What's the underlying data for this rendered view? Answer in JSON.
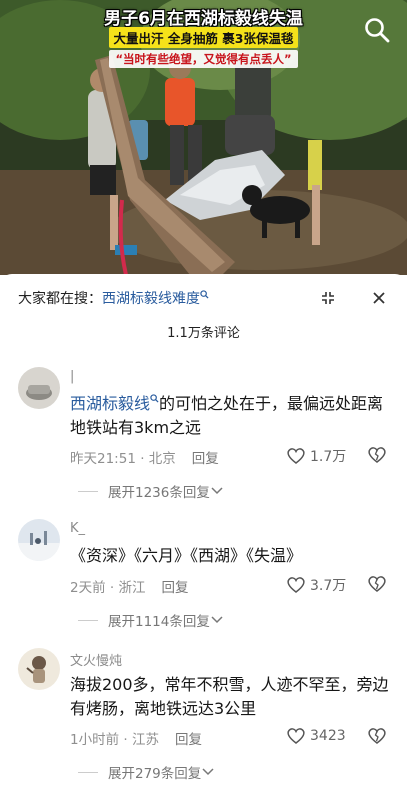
{
  "video": {
    "headline_line1": "男子6月在西湖标毅线失温",
    "headline_line2": "大量出汗 全身抽筋 裹3张保温毯",
    "headline_line3": "“当时有些绝望，又觉得有点丢人”"
  },
  "search_bar": {
    "prefix": "大家都在搜：",
    "query": "西湖标毅线难度"
  },
  "comments_count": "1.1万条评论",
  "comments": [
    {
      "username": "|",
      "text_tag": "西湖标毅线",
      "text_rest": "的可怕之处在于，最偏远处距离地铁站有3km之远",
      "meta": "昨天21:51 · 北京",
      "reply_label": "回复",
      "likes": "1.7万",
      "expand_label": "展开1236条回复"
    },
    {
      "username": "K_",
      "text_tag": "",
      "text_rest": "《资深》《六月》《西湖》《失温》",
      "meta": "2天前 · 浙江",
      "reply_label": "回复",
      "likes": "3.7万",
      "expand_label": "展开1114条回复"
    },
    {
      "username": "文火慢炖",
      "text_tag": "",
      "text_rest": "海拔200多，常年不积雪，人迹不罕至，旁边有烤肠，离地铁远达3公里",
      "meta": "1小时前 · 江苏",
      "reply_label": "回复",
      "likes": "3423",
      "expand_label": "展开279条回复"
    }
  ],
  "colors": {
    "link_blue": "#2a5c9e",
    "meta_gray": "#8f8f8f",
    "headline_yellow": "#f5e21a",
    "headline_red": "#c8141c"
  }
}
